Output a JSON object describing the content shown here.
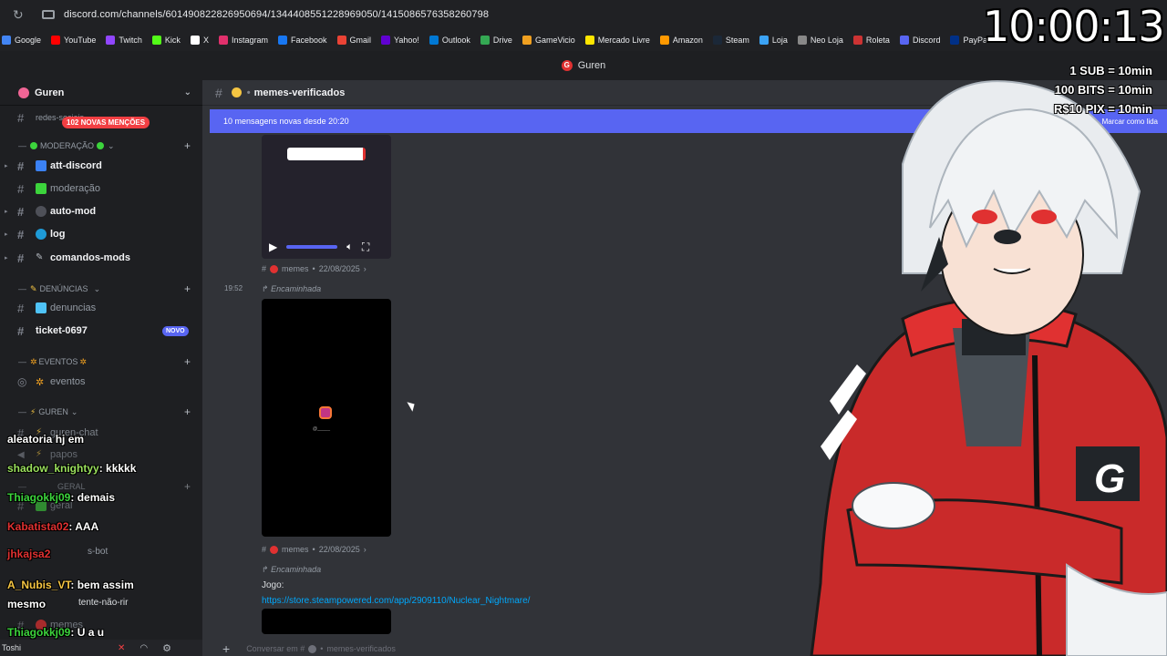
{
  "browser": {
    "url": "discord.com/channels/601490822826950694/1344408551228969050/1415086576358260798",
    "bookmarks": [
      "Google",
      "YouTube",
      "Twitch",
      "Kick",
      "X",
      "Instagram",
      "Facebook",
      "Gmail",
      "Yahoo!",
      "Outlook",
      "Drive",
      "GameVicio",
      "Mercado Livre",
      "Amazon",
      "Steam",
      "Loja",
      "Neo Loja",
      "Roleta",
      "Discord",
      "PayPal"
    ],
    "bookmark_colors": [
      "#4285f4",
      "#ff0000",
      "#9146ff",
      "#53fc18",
      "#ffffff",
      "#e1306c",
      "#1877f2",
      "#ea4335",
      "#6001d2",
      "#0078d4",
      "#34a853",
      "#f0a020",
      "#ffe600",
      "#ff9900",
      "#1b2838",
      "#3ba3f5",
      "#888888",
      "#cc3333",
      "#5865f2",
      "#003087"
    ]
  },
  "app": {
    "title": "Guren"
  },
  "sidebar": {
    "server_name": "Guren",
    "mentions": "102 NOVAS MENÇÕES",
    "partial_top": "redes-sociais",
    "cat_moderacao": "MODERAÇÃO",
    "ch_att_discord": "att-discord",
    "ch_moderacao": "moderação",
    "ch_auto_mod": "auto-mod",
    "ch_log": "log",
    "ch_comandos_mods": "comandos-mods",
    "cat_denuncias": "DENÚNCIAS",
    "ch_denuncias": "denuncias",
    "ch_ticket": "ticket-0697",
    "novo_badge": "NOVO",
    "cat_eventos": "EVENTOS",
    "ch_eventos": "eventos",
    "cat_guren": "GUREN",
    "ch_guren_chat": "guren-chat",
    "ch_papos": "papos",
    "cat_geral": "GERAL",
    "ch_geral": "geral",
    "ch_bot": "s-bot",
    "ch_tente": "tente-não-rir",
    "ch_memes": "memes",
    "user": "Toshi"
  },
  "stream_chat": [
    {
      "user": "aleatoria hj em",
      "msg": "",
      "color": "#ffffff"
    },
    {
      "user": "shadow_knightyy",
      "msg": "kkkkk",
      "color": "#9be15d"
    },
    {
      "user": "Thiagokkj09",
      "msg": "demais",
      "color": "#3cd43c"
    },
    {
      "user": "Kabatista02",
      "msg": "AAA",
      "color": "#e03131"
    },
    {
      "user": "jhkajsa2",
      "msg": "",
      "color": "#e03131"
    },
    {
      "user": "A_Nubis_VT",
      "msg": "bem assim",
      "color": "#f5c542"
    },
    {
      "user": "mesmo",
      "msg": "",
      "color": "#ffffff"
    },
    {
      "user": "Thiagokkj09",
      "msg": "U a u",
      "color": "#3cd43c"
    }
  ],
  "channel": {
    "name": "memes-verificados",
    "new_messages": "10 mensagens novas desde 20:20",
    "mark_read": "Marcar como lida",
    "meta1_channel": "memes",
    "meta1_date": "22/08/2025",
    "time2": "19:52",
    "forwarded": "Encaminhada",
    "meta2_channel": "memes",
    "meta2_date": "22/08/2025",
    "forwarded2": "Encaminhada",
    "jogo_label": "Jogo:",
    "jogo_link": "https://store.steampowered.com/app/2909110/Nuclear_Nightmare/",
    "composer_placeholder": "Conversar em #",
    "composer_channel": "memes-verificados"
  },
  "overlay": {
    "clock": "10:00:13",
    "rule1": "1 SUB = 10min",
    "rule2": "100 BITS = 10min",
    "rule3": "R$10 PIX = 10min"
  },
  "colors": {
    "blurple": "#5865f2",
    "link": "#00a8fc",
    "danger": "#f23f43"
  }
}
